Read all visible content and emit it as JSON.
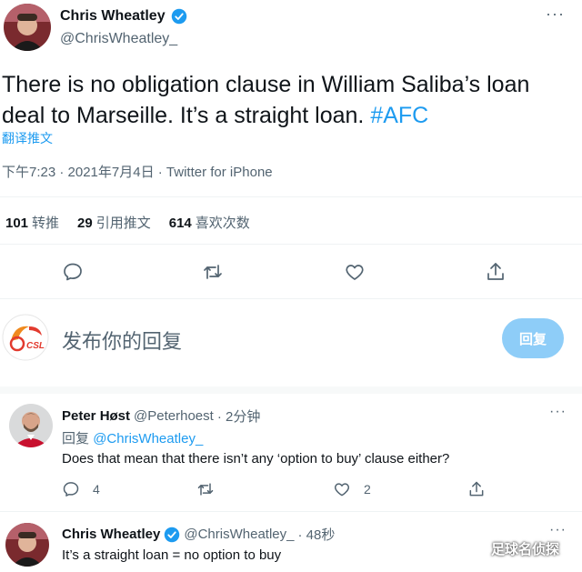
{
  "main_tweet": {
    "name": "Chris Wheatley",
    "handle": "@ChrisWheatley_",
    "text_plain": "There is no obligation clause in William Saliba’s loan deal to Marseille. It’s a straight loan. ",
    "hashtag": "#AFC",
    "translate": "翻译推文",
    "meta": "下午7:23 · 2021年7月4日 · Twitter for iPhone",
    "stats": {
      "retweets_count": "101",
      "retweets_label": "转推",
      "quotes_count": "29",
      "quotes_label": "引用推文",
      "likes_count": "614",
      "likes_label": "喜欢次数"
    },
    "more": "···"
  },
  "compose": {
    "placeholder": "发布你的回复",
    "reply_button": "回复",
    "avatar_text": "CSL"
  },
  "replies": [
    {
      "name": "Peter Høst",
      "handle": "@Peterhoest",
      "time": "· 2分钟",
      "reply_to_prefix": "回复",
      "reply_to_handle": "@ChrisWheatley_",
      "text": "Does that mean that there isn’t any ‘option to buy’ clause either?",
      "reply_count": "4",
      "like_count": "2",
      "more": "···"
    },
    {
      "name": "Chris Wheatley",
      "handle": "@ChrisWheatley_",
      "time": "· 48秒",
      "text": "It’s a straight loan = no option to buy",
      "more": "···"
    }
  ],
  "watermark": "足球名侦探",
  "colors": {
    "accent": "#1d9bf0",
    "reply_button_bg": "#8ecdf8",
    "secondary_text": "#536471"
  }
}
